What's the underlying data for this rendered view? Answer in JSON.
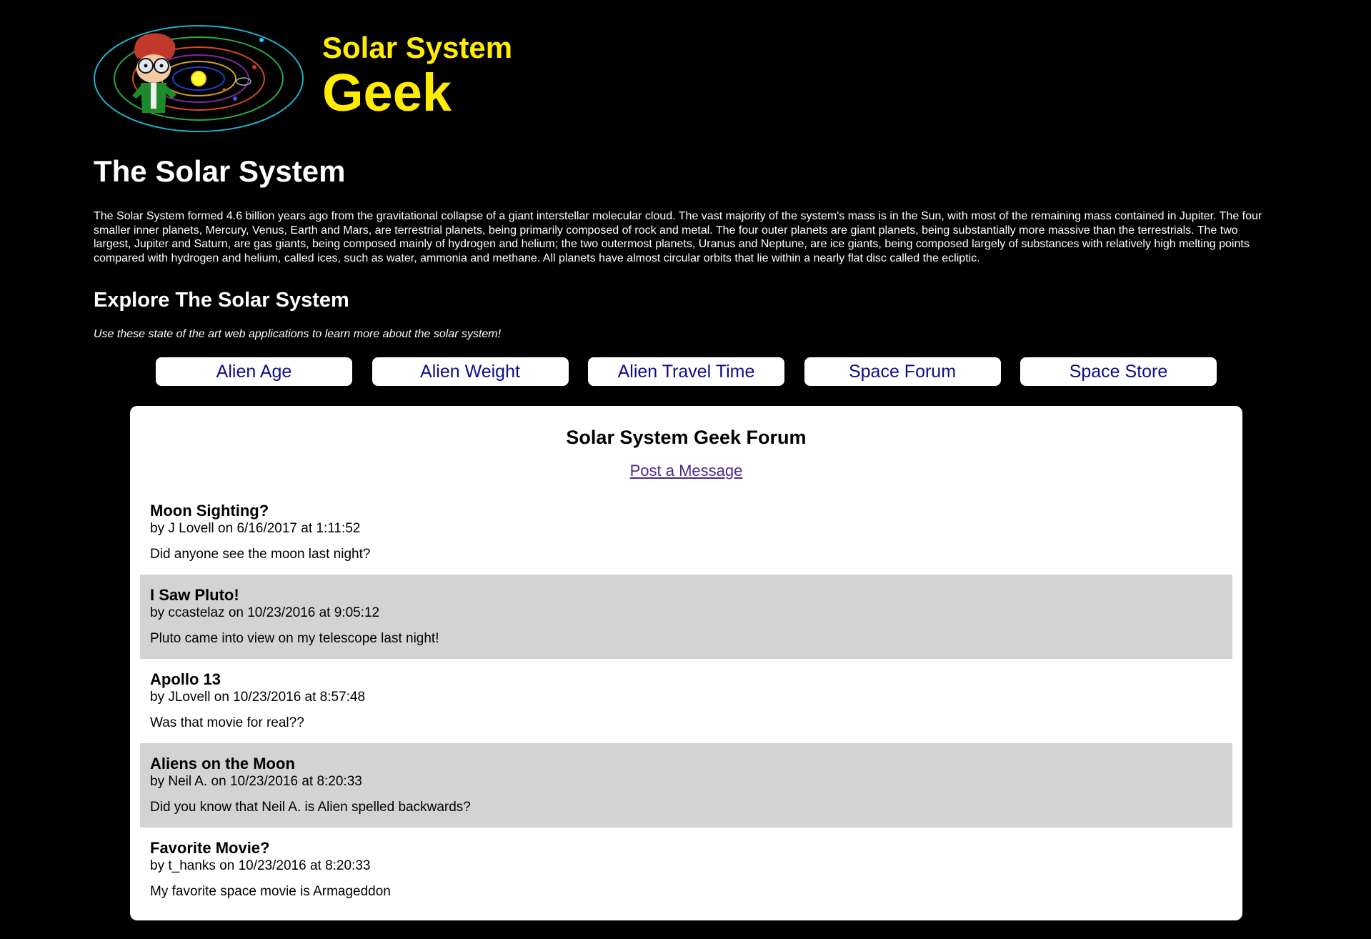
{
  "logo": {
    "line1": "Solar System",
    "line2": "Geek",
    "text_color": "#ffec00"
  },
  "page": {
    "title": "The Solar System",
    "intro": "The Solar System formed 4.6 billion years ago from the gravitational collapse of a giant interstellar molecular cloud. The vast majority of the system's mass is in the Sun, with most of the remaining mass contained in Jupiter. The four smaller inner planets, Mercury, Venus, Earth and Mars, are terrestrial planets, being primarily composed of rock and metal. The four outer planets are giant planets, being substantially more massive than the terrestrials. The two largest, Jupiter and Saturn, are gas giants, being composed mainly of hydrogen and helium; the two outermost planets, Uranus and Neptune, are ice giants, being composed largely of substances with relatively high melting points compared with hydrogen and helium, called ices, such as water, ammonia and methane. All planets have almost circular orbits that lie within a nearly flat disc called the ecliptic."
  },
  "explore": {
    "title": "Explore The Solar System",
    "subtitle": "Use these state of the art web applications to learn more about the solar system!"
  },
  "nav": {
    "items": [
      {
        "label": "Alien Age"
      },
      {
        "label": "Alien Weight"
      },
      {
        "label": "Alien Travel Time"
      },
      {
        "label": "Space Forum"
      },
      {
        "label": "Space Store"
      }
    ],
    "button_text_color": "#0d0d8c"
  },
  "forum": {
    "title": "Solar System Geek Forum",
    "post_link": "Post a Message",
    "posts": [
      {
        "title": "Moon Sighting?",
        "meta": "by J Lovell on 6/16/2017 at 1:11:52",
        "body": "Did anyone see the moon last night?"
      },
      {
        "title": "I Saw Pluto!",
        "meta": "by ccastelaz on 10/23/2016 at 9:05:12",
        "body": "Pluto came into view on my telescope last night!"
      },
      {
        "title": "Apollo 13",
        "meta": "by JLovell on 10/23/2016 at 8:57:48",
        "body": "Was that movie for real??"
      },
      {
        "title": "Aliens on the Moon",
        "meta": "by Neil A. on 10/23/2016 at 8:20:33",
        "body": "Did you know that Neil A. is Alien spelled backwards?"
      },
      {
        "title": "Favorite Movie?",
        "meta": "by t_hanks on 10/23/2016 at 8:20:33",
        "body": "My favorite space movie is Armageddon"
      }
    ],
    "alt_row_color": "#d3d3d3"
  }
}
